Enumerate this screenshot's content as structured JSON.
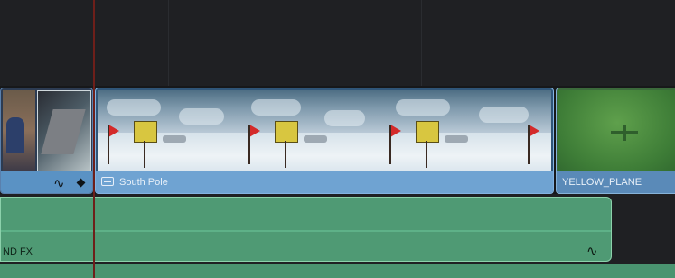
{
  "timeline": {
    "clips": [
      {
        "label": ""
      },
      {
        "label": "South Pole"
      },
      {
        "label": "YELLOW_PLANE"
      }
    ],
    "audio": {
      "label": "ND FX"
    },
    "icons": {
      "audio_keyframe": "audio-waveform-icon",
      "clip_icon": "video-clip-icon",
      "keyframe": "keyframe-diamond-icon"
    }
  }
}
